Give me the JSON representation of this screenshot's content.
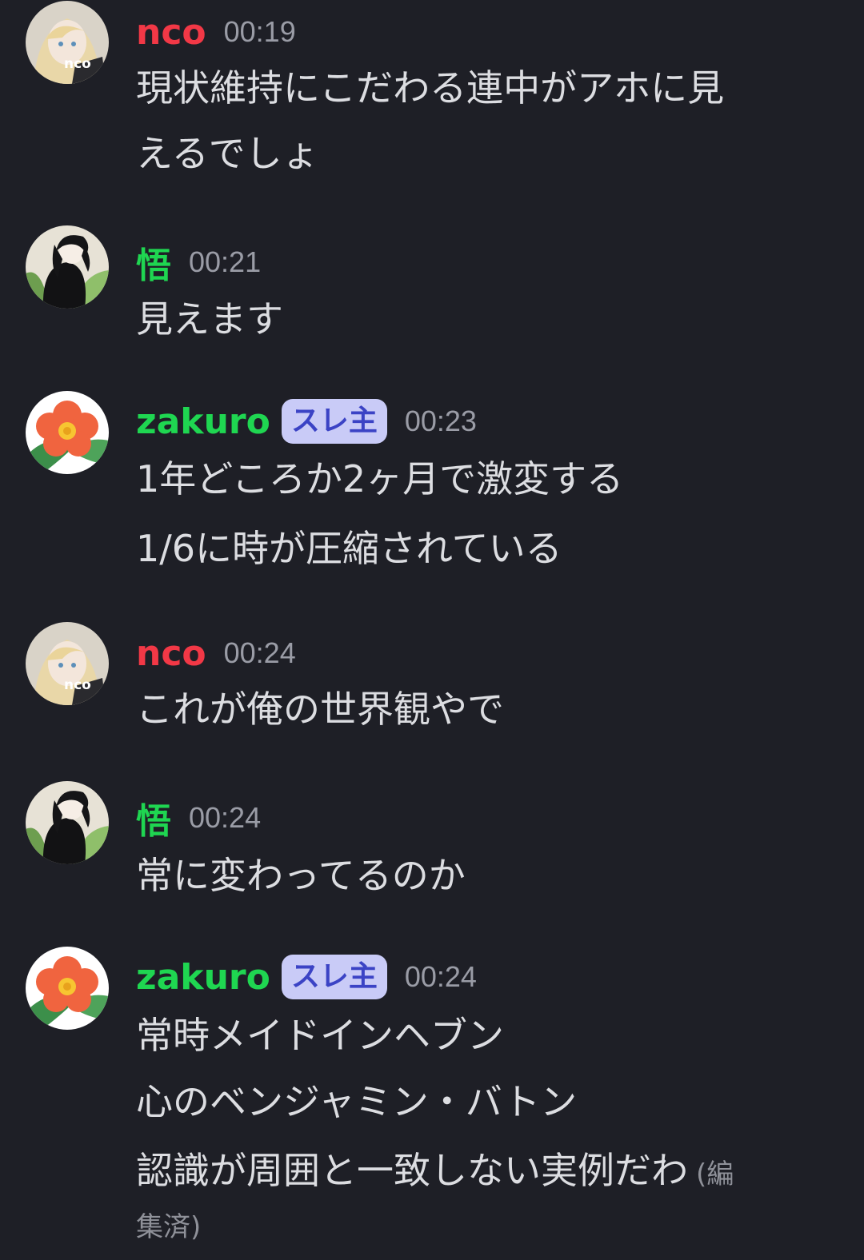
{
  "colors": {
    "background": "#1e1f26",
    "author_red": "#f23846",
    "author_green": "#1fd651",
    "badge_bg": "#c9cbf7",
    "badge_text": "#3b43c5",
    "timestamp": "#9a9ca6",
    "text": "#dcdde1"
  },
  "messages": [
    {
      "author": "nco",
      "author_color": "#f23846",
      "avatar": "nco-avatar",
      "time": "00:19",
      "lines": [
        "現状維持にこだわる連中がアホに見",
        "えるでしょ"
      ]
    },
    {
      "author": "悟",
      "author_color": "#1fd651",
      "avatar": "satoru-avatar",
      "time": "00:21",
      "lines": [
        "見えます"
      ]
    },
    {
      "author": "zakuro",
      "author_color": "#1fd651",
      "avatar": "zakuro-avatar",
      "badge": "スレ主",
      "time": "00:23",
      "lines": [
        "1年どころか2ヶ月で激変する",
        "1/6に時が圧縮されている"
      ]
    },
    {
      "author": "nco",
      "author_color": "#f23846",
      "avatar": "nco-avatar",
      "time": "00:24",
      "lines": [
        "これが俺の世界観やで"
      ]
    },
    {
      "author": "悟",
      "author_color": "#1fd651",
      "avatar": "satoru-avatar",
      "time": "00:24",
      "lines": [
        "常に変わってるのか"
      ]
    },
    {
      "author": "zakuro",
      "author_color": "#1fd651",
      "avatar": "zakuro-avatar",
      "badge": "スレ主",
      "time": "00:24",
      "lines": [
        "常時メイドインヘブン",
        "心のベンジャミン・バトン",
        "認識が周囲と一致しない実例だわ",
        "集済)"
      ],
      "edited": "(編"
    }
  ],
  "avatar_caption": "nco"
}
